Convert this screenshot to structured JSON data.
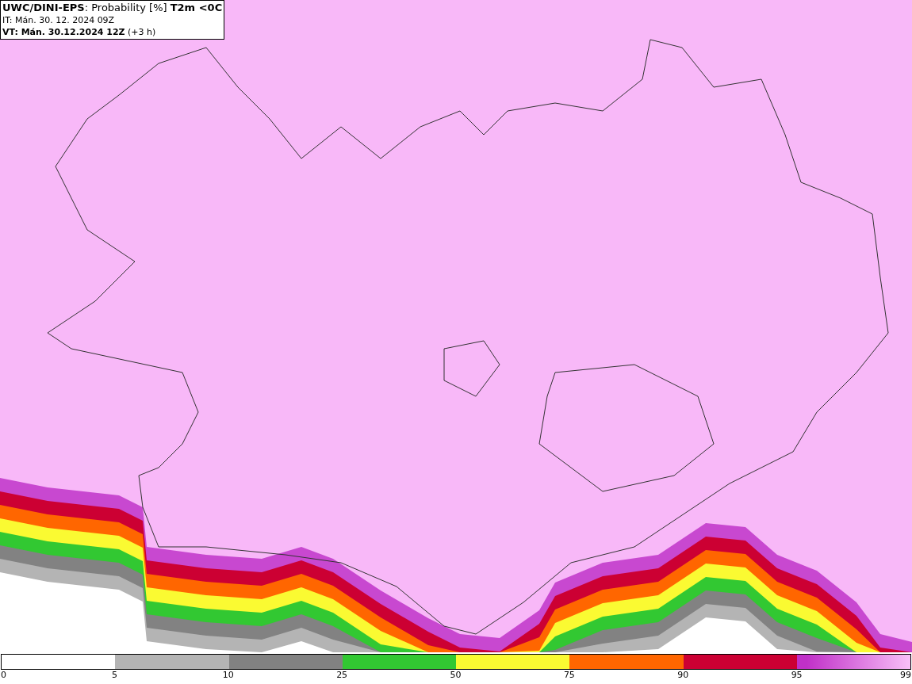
{
  "header": {
    "line_1": "**UWC/DINI-EPS**: Probability [%] **T2m <0C**",
    "line_2": "IT: Mán. 30. 12. 2024 09Z",
    "line_3": "**VT: Mán. 30.12.2024 12Z** (+3 h)"
  },
  "legend": {
    "segments": [
      {
        "color": "#b4b4b4"
      },
      {
        "color": "#828282"
      },
      {
        "color": "#32c832"
      },
      {
        "color": "#fafa32"
      },
      {
        "color": "#ff6600"
      },
      {
        "color": "#cc0033"
      },
      {
        "color": "#c030c8"
      }
    ],
    "ticks": [
      "0",
      "5",
      "10",
      "25",
      "50",
      "75",
      "90",
      "95",
      "99"
    ]
  }
}
